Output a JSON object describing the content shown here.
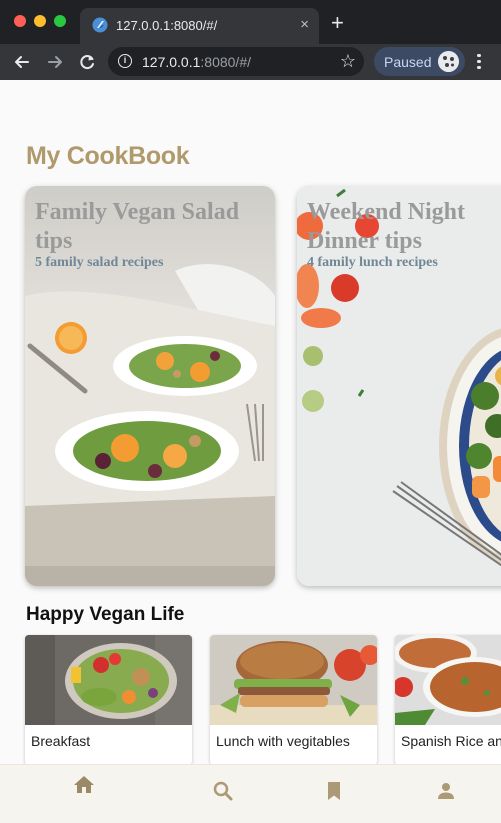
{
  "browser": {
    "tab_title": "127.0.0.1:8080/#/",
    "tab_close": "×",
    "new_tab": "+",
    "url_host": "127.0.0.1",
    "url_rest": ":8080/#/",
    "profile_status": "Paused"
  },
  "app": {
    "title": "My CookBook",
    "featured": [
      {
        "title": "Family Vegan Salad tips",
        "subtitle": "5 family salad recipes"
      },
      {
        "title": "Weekend Night Dinner tips",
        "subtitle": "4 family lunch recipes"
      }
    ],
    "section_title": "Happy Vegan Life",
    "recipes": [
      {
        "label": "Breakfast"
      },
      {
        "label": "Lunch with vegitables"
      },
      {
        "label": "Spanish Rice and"
      }
    ],
    "bottom_nav": [
      {
        "icon": "home-icon",
        "active": true
      },
      {
        "icon": "search-icon",
        "active": false
      },
      {
        "icon": "bookmark-icon",
        "active": false
      },
      {
        "icon": "person-icon",
        "active": false
      }
    ],
    "colors": {
      "accent": "#b09a6c",
      "card_subtitle": "#6f8796"
    }
  }
}
